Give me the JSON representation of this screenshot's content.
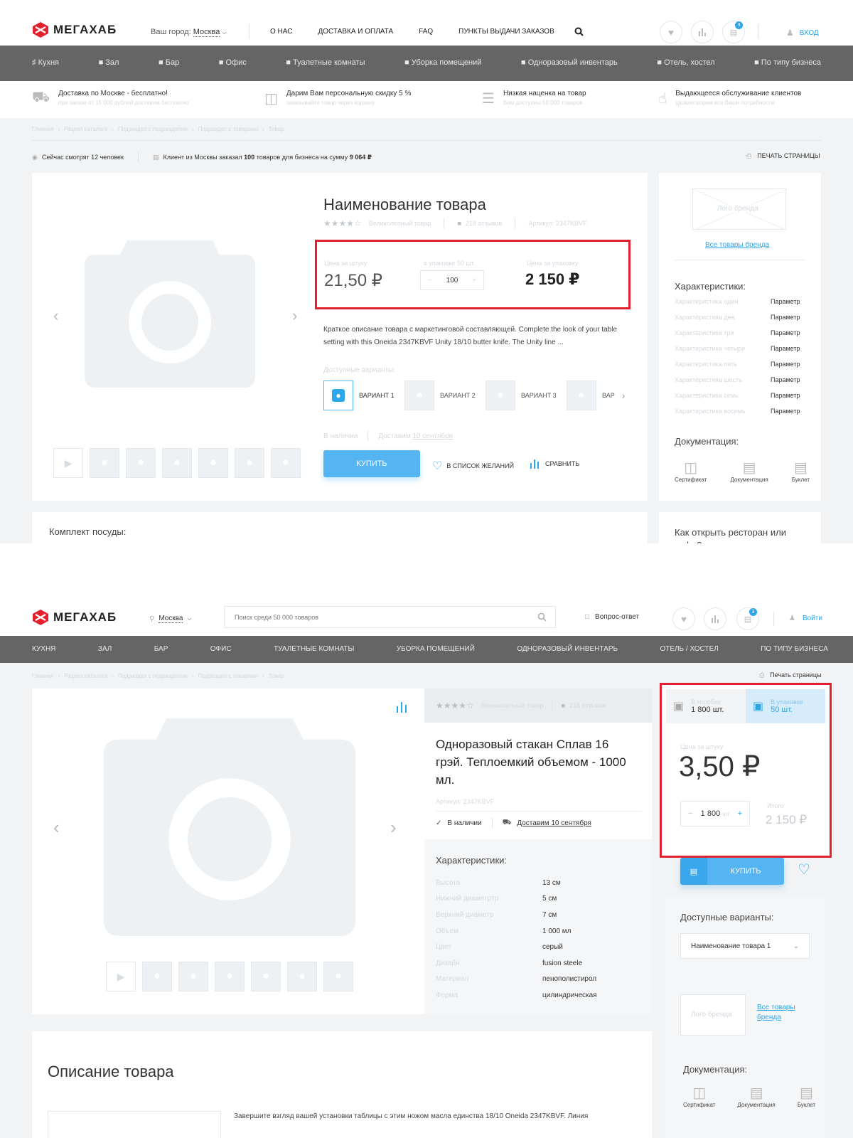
{
  "top": {
    "logo": "МЕГАХАБ",
    "city_label": "Ваш город:",
    "city": "Москва",
    "nav": [
      "О НАС",
      "ДОСТАВКА И ОПЛАТА",
      "FAQ",
      "ПУНКТЫ ВЫДАЧИ ЗАКАЗОВ"
    ],
    "cart_count": "3",
    "login": "ВХОД",
    "categories": [
      "Кухня",
      "Зал",
      "Бар",
      "Офис",
      "Туалетные комнаты",
      "Уборка помещений",
      "Одноразовый инвентарь",
      "Отель, хостел",
      "По типу бизнеса"
    ],
    "benefits": [
      {
        "title": "Доставка по Москве - бесплатно!",
        "sub": "при заказе от 15 000 рублей доставим бесплатно"
      },
      {
        "title": "Дарим Вам персональную скидку 5 %",
        "sub": "заказывайте товар через корзину"
      },
      {
        "title": "Низкая наценка на товар",
        "sub": "Вам доступны 50 000 товаров"
      },
      {
        "title": "Выдающееся обслуживание клиентов",
        "sub": "удовлетворим все Ваши потребности"
      }
    ],
    "breadcrumbs": [
      "Главная",
      "Раздел каталога",
      "Подраздел с подразделом",
      "Подраздел с товарами",
      "Товар"
    ],
    "watching": "Сейчас смотрят 12 человек",
    "order_pre": "Клиент из Москвы заказал",
    "order_count": "100",
    "order_mid": "товаров для бизнеса на сумму",
    "order_sum": "9 064 ₽",
    "print": "ПЕЧАТЬ СТРАНИЦЫ",
    "product": {
      "title": "Наименование товара",
      "rating_label": "Великолепный товар",
      "reviews": "218 отзывов",
      "article": "Артикул: 2347KBVF",
      "price_unit_label": "Цена за штуку",
      "price_unit": "21,50 ₽",
      "pack_label": "в упаковке 50 шт.",
      "qty": "100",
      "price_pack_label": "Цена за упаковку",
      "price_pack": "2 150 ₽",
      "description": "Краткое описание товара с маркетинговой составляющей. Complete the look of your table setting with this Oneida 2347KBVF Unity 18/10 butter knife. The Unity line ...",
      "variants_label": "Доступные варианты:",
      "variants": [
        "ВАРИАНТ 1",
        "ВАРИАНТ 2",
        "ВАРИАНТ 3",
        "ВАР"
      ],
      "stock": "В наличии",
      "delivery_pre": "Доставим",
      "delivery_date": "10 сентября",
      "buy": "КУПИТЬ",
      "wishlist": "В СПИСОК ЖЕЛАНИЙ",
      "compare": "СРАВНИТЬ"
    },
    "sidebar": {
      "brand_logo": "Лого бренда",
      "brand_link": "Все товары бренда",
      "specs_title": "Характеристики:",
      "specs": [
        {
          "name": "Характеристика один",
          "value": "Параметр"
        },
        {
          "name": "Характеристика два",
          "value": "Параметр"
        },
        {
          "name": "Характеристика три",
          "value": "Параметр"
        },
        {
          "name": "Характеристика четыре",
          "value": "Параметр"
        },
        {
          "name": "Характеристика пять",
          "value": "Параметр"
        },
        {
          "name": "Характеристика шесть",
          "value": "Параметр"
        },
        {
          "name": "Характеристика семь",
          "value": "Параметр"
        },
        {
          "name": "Характеристика восемь",
          "value": "Параметр"
        }
      ],
      "docs_title": "Документация:",
      "docs": [
        "Сертификат",
        "Документация",
        "Буклет"
      ]
    },
    "set_title": "Комплект посуды:",
    "article_title": "Как открыть ресторан или кафе?"
  },
  "bottom": {
    "logo": "МЕГАХАБ",
    "city": "Москва",
    "search_placeholder": "Поиск среди 50 000 товаров",
    "faq": "Вопрос-ответ",
    "cart_count": "3",
    "login": "Войти",
    "categories": [
      "КУХНЯ",
      "ЗАЛ",
      "БАР",
      "ОФИС",
      "ТУАЛЕТНЫЕ КОМНАТЫ",
      "УБОРКА ПОМЕЩЕНИЙ",
      "ОДНОРАЗОВЫЙ ИНВЕНТАРЬ",
      "ОТЕЛЬ / ХОСТЕЛ",
      "ПО ТИПУ БИЗНЕСА"
    ],
    "breadcrumbs": [
      "Главная",
      "Раздел каталога",
      "Подраздел с подразделом",
      "Подраздел с товарами",
      "Товар"
    ],
    "print": "Печать страницы",
    "product": {
      "rating_label": "Великолепный товар",
      "reviews": "218 отзывов",
      "title": "Одноразовый стакан Сплав 16 грэй. Теплоемкий объемом - 1000 мл.",
      "article": "Артикул: 2347KBVF",
      "stock": "В наличии",
      "delivery": "Доставим 10 сентября",
      "specs_title": "Характеристики:",
      "specs": [
        {
          "name": "Высота",
          "value": "13 см"
        },
        {
          "name": "Нижний диаметртр",
          "value": "5 см"
        },
        {
          "name": "Верхний диаметр",
          "value": "7 см"
        },
        {
          "name": "Объем",
          "value": "1 000 мл"
        },
        {
          "name": "Цвет",
          "value": "серый"
        },
        {
          "name": "Дизайн",
          "value": "fusion steele"
        },
        {
          "name": "Материал",
          "value": "пенополистирол"
        },
        {
          "name": "Форма",
          "value": "цилиндрическая"
        }
      ]
    },
    "buybox": {
      "box_label": "В коробке",
      "box_value": "1 800 шт.",
      "pack_label": "В упаковке",
      "pack_value": "50 шт.",
      "price_label": "Цена за штуку",
      "price": "3,50 ₽",
      "qty": "1 800",
      "qty_unit": "шт",
      "total_label": "Итого",
      "total": "2 150 ₽",
      "buy": "КУПИТЬ",
      "variants_label": "Доступные варианты:",
      "variant_selected": "Наименование товара 1",
      "brand_logo": "Лого бренда",
      "brand_link": "Все товары бренда",
      "docs_title": "Документация:",
      "docs": [
        "Сертификат",
        "Документация",
        "Буклет"
      ]
    },
    "desc_title": "Описание товара",
    "desc_text": "Завершите взгляд вашей установки таблицы с этим ножом масла единства 18/10 Oneida 2347KBVF. Линия"
  }
}
